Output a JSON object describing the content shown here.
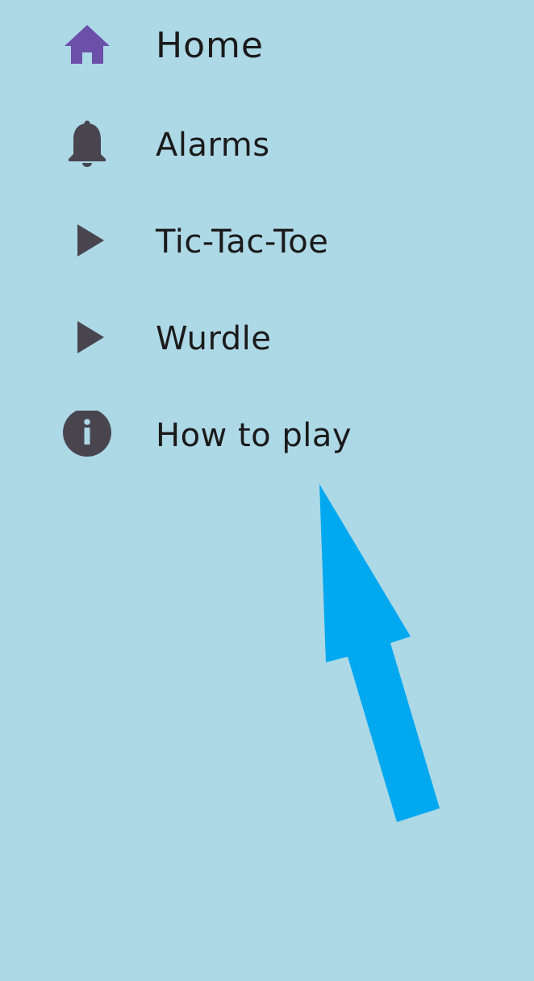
{
  "drawer": {
    "items": [
      {
        "label": "Home",
        "icon": "home-icon",
        "active": true
      },
      {
        "label": "Alarms",
        "icon": "bell-icon",
        "active": false
      },
      {
        "label": "Tic-Tac-Toe",
        "icon": "play-arrow-icon",
        "active": false
      },
      {
        "label": "Wurdle",
        "icon": "play-arrow-icon",
        "active": false
      },
      {
        "label": "How to play",
        "icon": "info-icon",
        "active": false
      }
    ]
  },
  "colors": {
    "background": "#add8e6",
    "active_icon": "#6b4fa8",
    "inactive_icon": "#48454e",
    "label_text": "#1a1a1a",
    "annotation_arrow": "#00a8f0"
  }
}
